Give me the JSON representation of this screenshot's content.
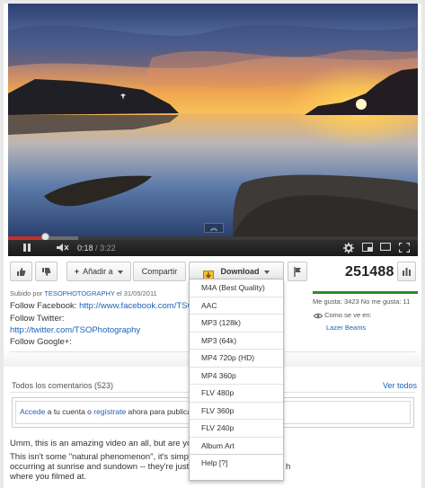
{
  "player": {
    "current_time": "0:18",
    "separator": "/",
    "total_time": "3:22",
    "progress_fraction": 0.089,
    "buffered_fraction": 0.17
  },
  "actions": {
    "add_to_label": "Añadir a",
    "share_label": "Compartir",
    "download_label": "Download"
  },
  "views": "251488",
  "likes": {
    "text": "Me gusta: 3423 No me gusta: 11",
    "like_fraction": 0.997,
    "seen_label": "Como se ve en:",
    "seen_link": "Lazer Beams"
  },
  "description": {
    "uploaded_prefix": "Subido por",
    "uploader": "TESOPHOTOGRAPHY",
    "uploaded_suffix": "el 31/05/2011",
    "follow_facebook_label": "Follow Facebook:",
    "facebook_url": "http://www.facebook.com/TSO",
    "follow_twitter_label": "Follow Twitter:",
    "twitter_url": "http://twitter.com/TSOPhotography",
    "follow_google_label": "Follow Google+:"
  },
  "comments": {
    "title": "Todos los comentarios (523)",
    "see_all": "Ver todos",
    "box_login": "Accede",
    "box_middle": "a tu cuenta o",
    "box_register": "regístrate",
    "box_suffix": "ahora para publica",
    "line1": "Umm, this is an amazing video an all, but are yo",
    "line2a": "This isn't some \"natural phenomenon\", it's simp",
    "line2b": "h",
    "line3": "occurring at sunrise and sundown -- they're just",
    "line4": "where you filmed at."
  },
  "download_menu": [
    "M4A (Best Quality)",
    "AAC",
    "MP3 (128k)",
    "MP3 (64k)",
    "MP4 720p (HD)",
    "MP4 360p",
    "FLV 480p",
    "FLV 360p",
    "FLV 240p",
    "Album Art",
    "Help [?]"
  ],
  "colors": {
    "link": "#1c62b9",
    "progress_played": "#c4302b",
    "like_bar": "#2a8b2a",
    "dislike_bar": "#590000"
  }
}
